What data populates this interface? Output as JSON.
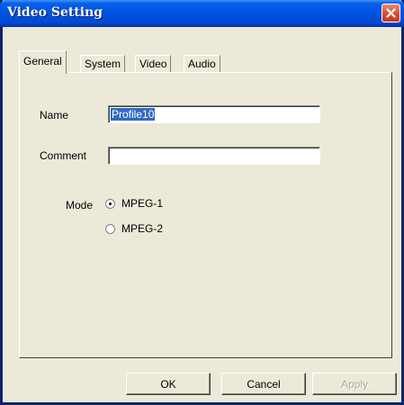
{
  "window": {
    "title": "Video Setting"
  },
  "tabs": [
    {
      "label": "General",
      "active": true
    },
    {
      "label": "System",
      "active": false
    },
    {
      "label": "Video",
      "active": false
    },
    {
      "label": "Audio",
      "active": false
    }
  ],
  "form": {
    "name_label": "Name",
    "name_value": "Profile10",
    "comment_label": "Comment",
    "comment_value": "",
    "mode_label": "Mode",
    "mode_options": [
      {
        "label": "MPEG-1",
        "selected": true
      },
      {
        "label": "MPEG-2",
        "selected": false
      }
    ]
  },
  "buttons": {
    "ok": "OK",
    "cancel": "Cancel",
    "apply": "Apply"
  },
  "colors": {
    "titlebar": "#0054E3",
    "face": "#ECE9D8",
    "selection": "#316AC5",
    "close": "#D6492B"
  },
  "icons": {
    "close": "close-icon"
  }
}
